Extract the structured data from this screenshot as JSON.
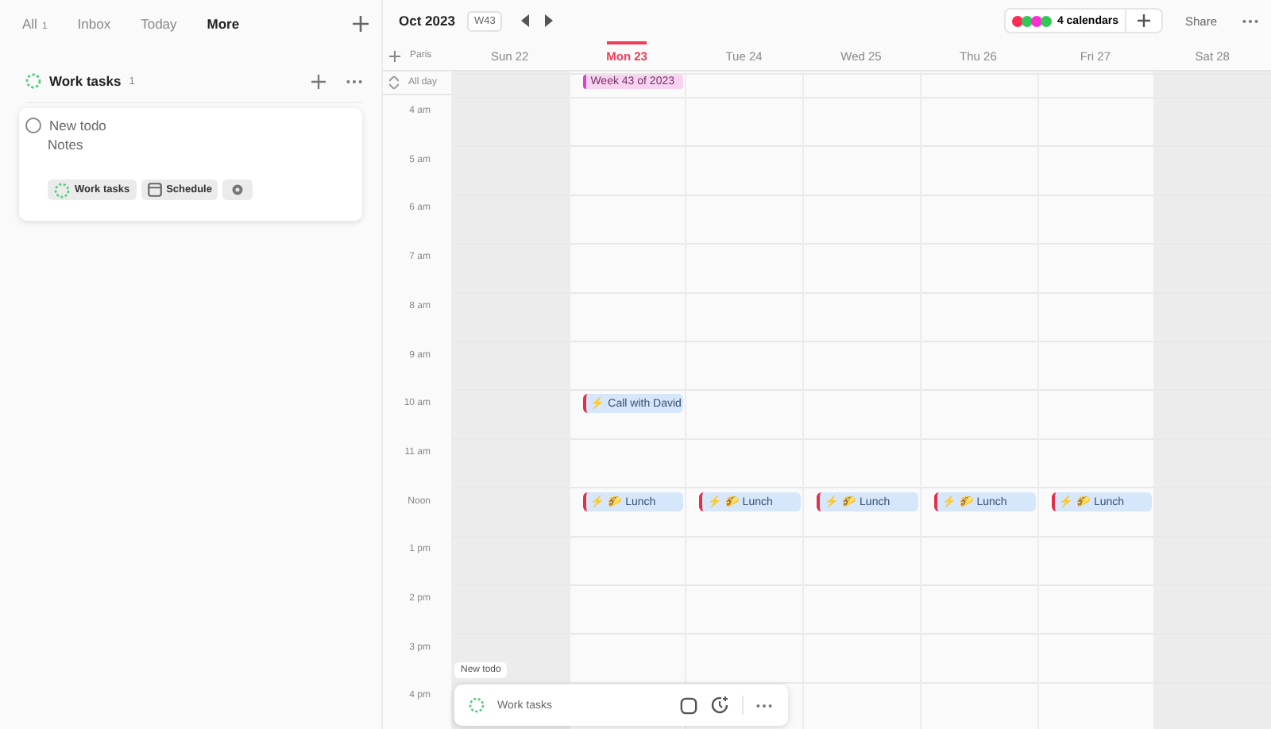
{
  "sidebar": {
    "tabs": [
      {
        "label": "All",
        "count": "1",
        "selected": false
      },
      {
        "label": "Inbox",
        "selected": false
      },
      {
        "label": "Today",
        "selected": false
      },
      {
        "label": "More",
        "selected": true
      }
    ],
    "list": {
      "title": "Work tasks",
      "count": "1"
    },
    "todo_card": {
      "checked": false,
      "title_placeholder": "New todo",
      "notes_placeholder": "Notes",
      "chips": [
        {
          "kind": "list",
          "label": "Work tasks"
        },
        {
          "kind": "schedule",
          "label": "Schedule"
        },
        {
          "kind": "settings"
        }
      ]
    }
  },
  "calendar": {
    "month": "Oct 2023",
    "week": "W43",
    "calendars": {
      "label": "4 calendars",
      "dots": [
        {
          "color": "#ff2d55"
        },
        {
          "color": "#34c759"
        },
        {
          "color": "#ff2dd1"
        },
        {
          "color": "#34c759"
        }
      ]
    },
    "share": "Share",
    "timezone": "Paris",
    "all_day_label": "All day",
    "days": [
      {
        "label": "Sun 22",
        "today": false,
        "weekend": true
      },
      {
        "label": "Mon 23",
        "today": true,
        "weekend": false,
        "all_day": [
          {
            "title": "Week 43 of 2023",
            "color": "#e040c8"
          }
        ]
      },
      {
        "label": "Tue 24",
        "today": false,
        "weekend": false
      },
      {
        "label": "Wed 25",
        "today": false,
        "weekend": false
      },
      {
        "label": "Thu 26",
        "today": false,
        "weekend": false
      },
      {
        "label": "Fri 27",
        "today": false,
        "weekend": false
      },
      {
        "label": "Sat 28",
        "today": false,
        "weekend": true
      }
    ],
    "hours": [
      {
        "label": "4 am"
      },
      {
        "label": "5 am"
      },
      {
        "label": "6 am"
      },
      {
        "label": "7 am"
      },
      {
        "label": "8 am"
      },
      {
        "label": "9 am"
      },
      {
        "label": "10 am",
        "cells": [
          {},
          {
            "events": [
              {
                "icon": "⚡",
                "title": "Call with David",
                "color": "#e0314b"
              }
            ]
          },
          {},
          {},
          {},
          {},
          {}
        ]
      },
      {
        "label": "11 am"
      },
      {
        "label": "Noon",
        "cells": [
          {},
          {
            "events": [
              {
                "icon": "⚡ 🌮",
                "title": "Lunch",
                "color": "#e0314b"
              }
            ]
          },
          {
            "events": [
              {
                "icon": "⚡ 🌮",
                "title": "Lunch",
                "color": "#e0314b"
              }
            ]
          },
          {
            "events": [
              {
                "icon": "⚡ 🌮",
                "title": "Lunch",
                "color": "#e0314b"
              }
            ]
          },
          {
            "events": [
              {
                "icon": "⚡ 🌮",
                "title": "Lunch",
                "color": "#e0314b"
              }
            ]
          },
          {
            "events": [
              {
                "icon": "⚡ 🌮",
                "title": "Lunch",
                "color": "#e0314b"
              }
            ]
          },
          {}
        ]
      },
      {
        "label": "1 pm"
      },
      {
        "label": "2 pm"
      },
      {
        "label": "3 pm"
      },
      {
        "label": "4 pm"
      }
    ]
  },
  "quick_bar": {
    "tooltip": "New todo",
    "list": "Work tasks"
  }
}
